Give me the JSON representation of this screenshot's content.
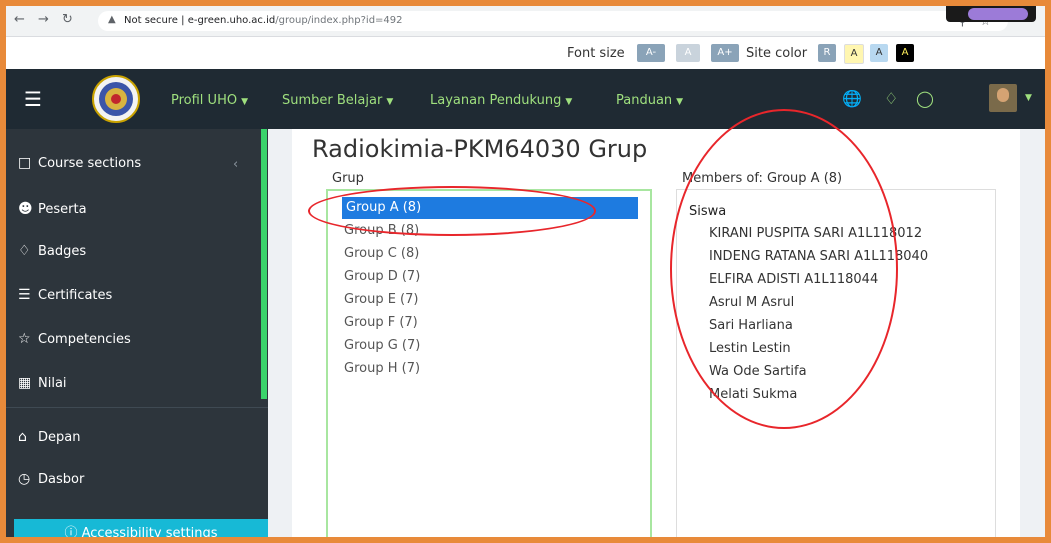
{
  "browser": {
    "not_secure": "Not secure",
    "url_domain": "e-green.uho.ac.id",
    "url_path": "/group/index.php?id=492"
  },
  "accessibility_bar": {
    "font_size_label": "Font size",
    "font_buttons": [
      "A-",
      "A",
      "A+"
    ],
    "site_color_label": "Site color",
    "color_buttons": [
      "R",
      "A",
      "A",
      "A"
    ]
  },
  "navbar": {
    "items": [
      "Profil UHO",
      "Sumber Belajar",
      "Layanan Pendukung",
      "Panduan"
    ]
  },
  "sidebar": {
    "items": [
      "Course sections",
      "Peserta",
      "Badges",
      "Certificates",
      "Competencies",
      "Nilai"
    ],
    "bottom_items": [
      "Depan",
      "Dasbor"
    ],
    "accessibility": "Accessibility settings"
  },
  "page": {
    "title": "Radiokimia-PKM64030 Grup",
    "groups_label": "Grup",
    "members_label": "Members of: Group A (8)"
  },
  "groups": [
    "Group A (8)",
    "Group B (8)",
    "Group C (8)",
    "Group D (7)",
    "Group E (7)",
    "Group F (7)",
    "Group G (7)",
    "Group H (7)"
  ],
  "members": {
    "role": "Siswa",
    "names": [
      "KIRANI PUSPITA SARI A1L118012",
      "INDENG RATANA SARI A1L118040",
      "ELFIRA ADISTI A1L118044",
      "Asrul M Asrul",
      "Sari Harliana",
      "Lestin Lestin",
      "Wa Ode Sartifa",
      "Melati Sukma"
    ]
  },
  "colors": {
    "navbar": "#1f2a33",
    "sidebar": "#2d353c",
    "nav_text": "#9fe07e",
    "selection": "#1e7be0",
    "annotation": "#e8262b",
    "frame": "#e88a3a"
  }
}
